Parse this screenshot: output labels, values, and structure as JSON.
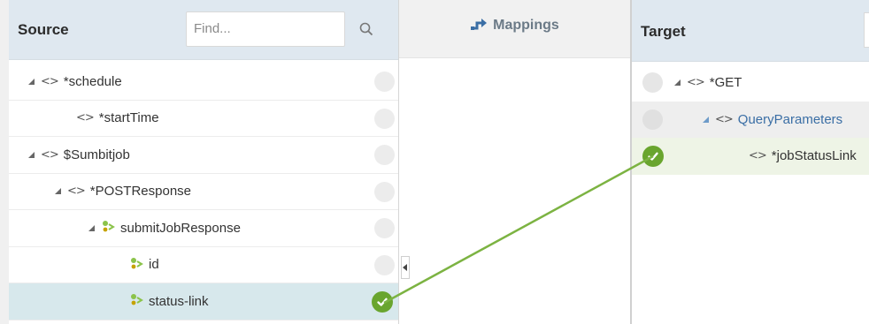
{
  "source": {
    "title": "Source",
    "find_placeholder": "Find...",
    "rows": [
      {
        "label": "*schedule",
        "indent": 0,
        "icon": "tag-icon",
        "expanded": true
      },
      {
        "label": "*startTime",
        "indent": 1,
        "icon": "tag-icon",
        "expanded": null
      },
      {
        "label": "$Sumbitjob",
        "indent": 0,
        "icon": "tag-icon",
        "expanded": true
      },
      {
        "label": "*POSTResponse",
        "indent": 1,
        "icon": "tag-icon",
        "expanded": true
      },
      {
        "label": "submitJobResponse",
        "indent": 2,
        "icon": "element-icon",
        "expanded": true
      },
      {
        "label": "id",
        "indent": 3,
        "icon": "element-icon",
        "expanded": null
      },
      {
        "label": "status-link",
        "indent": 3,
        "icon": "element-icon",
        "expanded": null,
        "selected": true,
        "mapped": true
      }
    ]
  },
  "mappings": {
    "title": "Mappings"
  },
  "target": {
    "title": "Target",
    "rows": [
      {
        "label": "*GET",
        "indent": 0,
        "icon": "tag-icon",
        "expanded": true
      },
      {
        "label": "QueryParameters",
        "indent": 1,
        "icon": "tag-icon",
        "expanded": true
      },
      {
        "label": "*jobStatusLink",
        "indent": 2,
        "icon": "tag-icon",
        "expanded": null,
        "mapped": true
      }
    ]
  },
  "colors": {
    "header_bg": "#dfe8f0",
    "selected_row": "#d7e8ec",
    "mapped_check": "#69a52e",
    "mapping_line": "#7cb342"
  }
}
